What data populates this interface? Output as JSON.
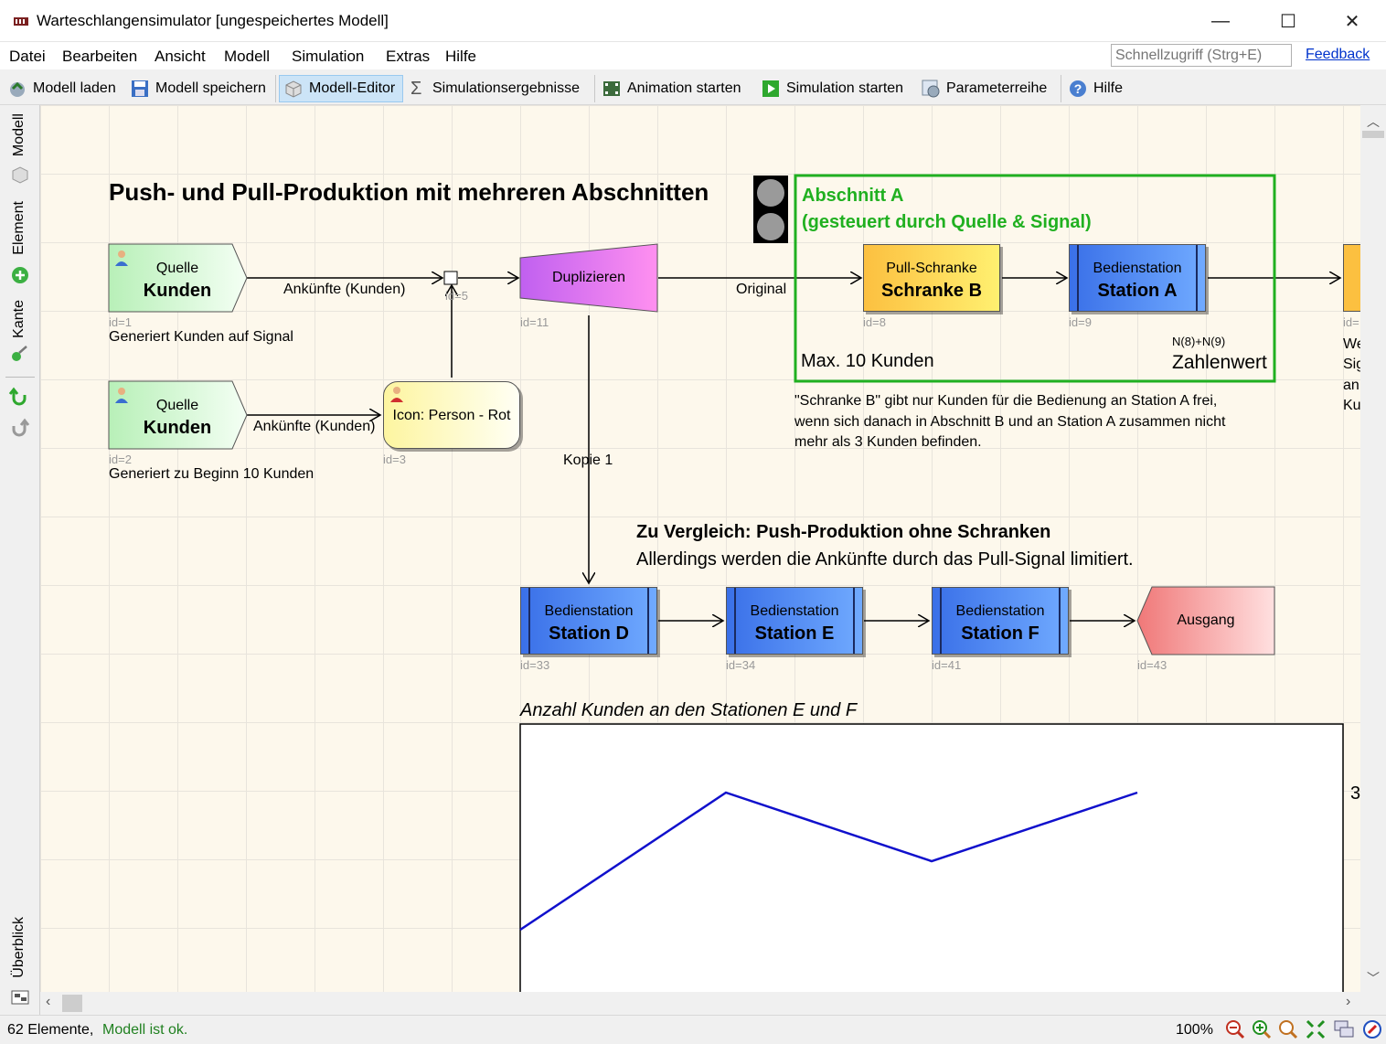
{
  "window": {
    "title": "Warteschlangensimulator [ungespeichertes Modell]",
    "minimize": "—",
    "maximize": "☐",
    "close": "✕"
  },
  "menu": [
    {
      "label": "Datei"
    },
    {
      "label": "Bearbeiten"
    },
    {
      "label": "Ansicht"
    },
    {
      "label": "Modell"
    },
    {
      "label": "Simulation"
    },
    {
      "label": "Extras"
    },
    {
      "label": "Hilfe"
    }
  ],
  "quick_access": {
    "placeholder": "Schnellzugriff (Strg+E)"
  },
  "feedback_label": "Feedback",
  "toolbar": {
    "load": "Modell laden",
    "save": "Modell speichern",
    "editor": "Modell-Editor",
    "results": "Simulationsergebnisse",
    "animation": "Animation starten",
    "simulation": "Simulation starten",
    "params": "Parameterreihe",
    "help": "Hilfe"
  },
  "sidebar": {
    "modell": "Modell",
    "element": "Element",
    "kante": "Kante",
    "ueberblick": "Überblick"
  },
  "model": {
    "title": "Push- und Pull-Produktion mit mehreren Abschnitten",
    "section_a": {
      "title_line1": "Abschnitt A",
      "title_line2": "(gesteuert durch Quelle & Signal)",
      "max": "Max. 10 Kunden",
      "expr": "N(8)+N(9)",
      "expr_label": "Zahlenwert"
    },
    "source1": {
      "type": "Quelle",
      "name": "Kunden",
      "id": "id=1",
      "desc": "Generiert Kunden auf Signal"
    },
    "source2": {
      "type": "Quelle",
      "name": "Kunden",
      "id": "id=2",
      "desc": "Generiert zu Beginn 10 Kunden"
    },
    "icon_node": {
      "label": "Icon: Person - Rot",
      "id": "id=3"
    },
    "junction_id": "id=5",
    "duplicate": {
      "label": "Duplizieren",
      "id": "id=11"
    },
    "barrier": {
      "type": "Pull-Schranke",
      "name": "Schranke B",
      "id": "id=8"
    },
    "station_a": {
      "type": "Bedienstation",
      "name": "Station A",
      "id": "id=9"
    },
    "station_d": {
      "type": "Bedienstation",
      "name": "Station D",
      "id": "id=33"
    },
    "station_e": {
      "type": "Bedienstation",
      "name": "Station E",
      "id": "id=34"
    },
    "station_f": {
      "type": "Bedienstation",
      "name": "Station F",
      "id": "id=41"
    },
    "exit": {
      "label": "Ausgang",
      "id": "id=43"
    },
    "edge_arrivals": "Ankünfte (Kunden)",
    "edge_original": "Original",
    "edge_copy": "Kopie 1",
    "offscreen_id": "id=",
    "offscreen_text": [
      "We",
      "Sig",
      "an",
      "Ku"
    ],
    "barrier_note": [
      "\"Schranke B\" gibt nur Kunden für die Bedienung an Station A frei,",
      "wenn sich danach in Abschnitt B und an Station A zusammen nicht",
      "mehr als 3 Kunden befinden."
    ],
    "compare_title": "Zu Vergleich: Push-Produktion ohne Schranken",
    "compare_sub": "Allerdings werden die Ankünfte durch das Pull-Signal limitiert."
  },
  "chart_data": {
    "type": "line",
    "title": "Anzahl Kunden an den Stationen E und F",
    "x": [
      0,
      1,
      2,
      3
    ],
    "series": [
      {
        "values": [
          1,
          3,
          2,
          3
        ],
        "color": "#1010cc"
      }
    ],
    "ylim": [
      0,
      4
    ],
    "y_tick_visible": "3"
  },
  "status": {
    "elements": "62 Elemente,",
    "ok": "Modell ist ok.",
    "zoom": "100%"
  }
}
